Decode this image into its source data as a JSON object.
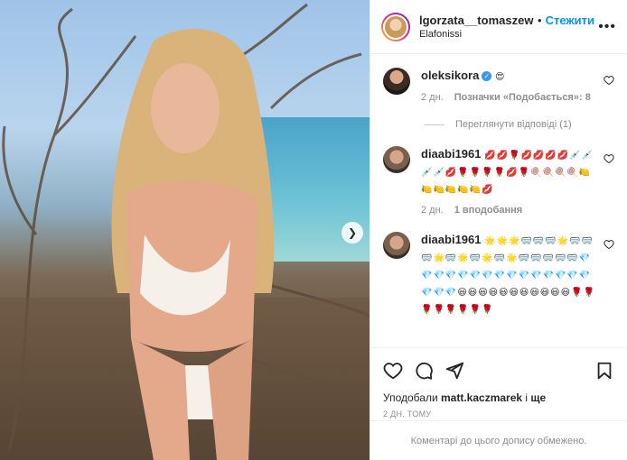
{
  "post": {
    "author": "lgorzata__tomaszewska",
    "follow_label": "Стежити",
    "separator": "•",
    "location": "Elafonissi",
    "more_label": "•••"
  },
  "comments": [
    {
      "user": "oleksikora",
      "verified": true,
      "text": "😍",
      "time": "2 дн.",
      "likes_label": "Позначки «Подобається»: 8",
      "replies_label": "Переглянути відповіді (1)"
    },
    {
      "user": "diaabi1961",
      "text": "💋💋🌹💋💋💋💋💉💉💉💉💋🌹🌹🌹🌹💋🌹🍭🍭🍭🍭🍋🍋🍋🍋🍋🍋💋",
      "time": "2 дн.",
      "reply_label": "1 вподобання"
    },
    {
      "user": "diaabi1961",
      "text": "🌟🌟🌟🥽🥽🥽🌟🥽🥽🥽🌟🥽🌟🥽🌟🥽🌟🥽🥽🥽🥽🥽💎💎💎💎💎💎💎💎💎💎💎💎💎💎💎💎💎💎😃😃😃😃😃😃😃😃😃😃😃🌹🌹🌹🌹🌹🌹🌹🌹"
    }
  ],
  "footer": {
    "liked_prefix": "Уподобали",
    "liked_user": "matt.kaczmarek",
    "liked_and": "і",
    "liked_more": "ще",
    "time": "2 ДН. ТОМУ",
    "comments_disabled": "Коментарі до цього допису обмежено."
  },
  "colors": {
    "accent": "#0095f6",
    "muted": "#8e8e8e",
    "border": "#efefef"
  },
  "icons": [
    "heart-icon",
    "comment-icon",
    "share-icon",
    "bookmark-icon",
    "chevron-right-icon",
    "more-icon",
    "verified-icon"
  ]
}
